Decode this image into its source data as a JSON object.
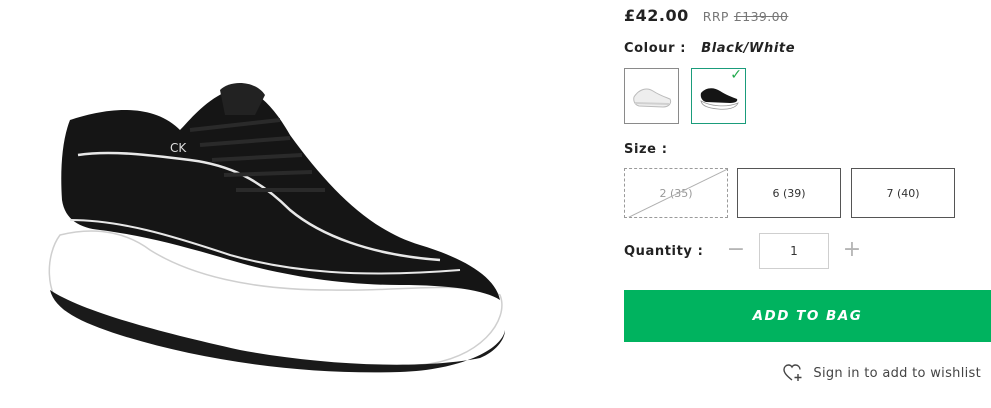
{
  "product": {
    "price": "£42.00",
    "rrp_label": "RRP",
    "rrp_value": "£139.00",
    "image_alt_icon": "sneaker-product-image"
  },
  "colour": {
    "label": "Colour :",
    "value": "Black/White",
    "options": [
      {
        "name": "white",
        "icon": "white-sneaker-thumbnail",
        "selected": false
      },
      {
        "name": "black-white",
        "icon": "black-sneaker-thumbnail",
        "selected": true
      }
    ],
    "accent": "#1a9c7b",
    "check_icon": "checkmark-icon"
  },
  "size": {
    "label": "Size :",
    "options": [
      {
        "label": "2 (35)",
        "available": false
      },
      {
        "label": "6 (39)",
        "available": true
      },
      {
        "label": "7 (40)",
        "available": true
      }
    ]
  },
  "quantity": {
    "label": "Quantity :",
    "value": "1",
    "minus": "−",
    "plus": "+"
  },
  "add_to_bag": {
    "label": "ADD TO BAG",
    "color": "#00b35f"
  },
  "wishlist": {
    "label": "Sign in to add to wishlist",
    "icon": "heart-plus-icon"
  }
}
